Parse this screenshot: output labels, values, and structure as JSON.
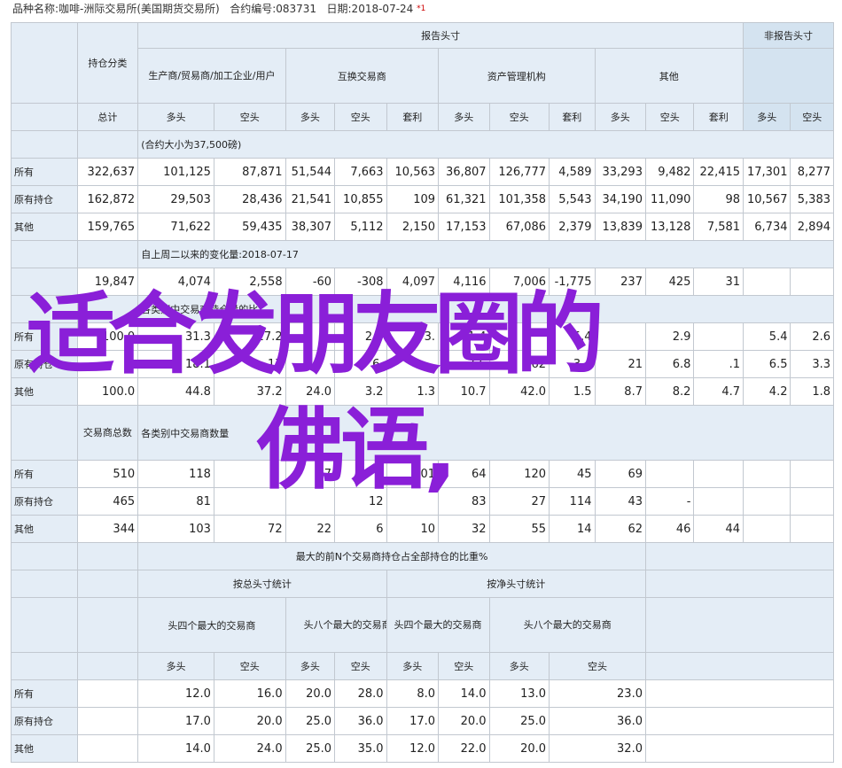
{
  "meta": {
    "variety": "品种名称:咖啡-洲际交易所(美国期货交易所)",
    "code": "合约编号:083731",
    "date": "日期:2018-07-24",
    "note": "*1"
  },
  "headers": {
    "reportable": "报告头寸",
    "nonreportable": "非报告头寸",
    "holding_class": "持仓分类",
    "producer": "生产商/贸易商/加工企业/用户",
    "swap": "互换交易商",
    "managed": "资产管理机构",
    "other": "其他",
    "total": "总计",
    "long": "多头",
    "short": "空头",
    "spread": "套利"
  },
  "sections": {
    "positions": "(合约大小为37,500磅)",
    "change": "自上周二以来的变化量:2018-07-17",
    "percent": "各类别中交易商持仓量的比",
    "traders_label": "交易商总数",
    "traders": "各类别中交易商数量"
  },
  "row_labels": {
    "all": "所有",
    "old": "原有持仓",
    "other": "其他"
  },
  "positions_rows": [
    {
      "label": "所有",
      "values": [
        "322,637",
        "101,125",
        "87,871",
        "51,544",
        "7,663",
        "10,563",
        "36,807",
        "126,777",
        "4,589",
        "33,293",
        "9,482",
        "22,415",
        "17,301",
        "8,277"
      ]
    },
    {
      "label": "原有持仓",
      "values": [
        "162,872",
        "29,503",
        "28,436",
        "21,541",
        "10,855",
        "109",
        "61,321",
        "101,358",
        "5,543",
        "34,190",
        "11,090",
        "98",
        "10,567",
        "5,383"
      ]
    },
    {
      "label": "其他",
      "values": [
        "159,765",
        "71,622",
        "59,435",
        "38,307",
        "5,112",
        "2,150",
        "17,153",
        "67,086",
        "2,379",
        "13,839",
        "13,128",
        "7,581",
        "6,734",
        "2,894"
      ]
    }
  ],
  "change_row": {
    "values": [
      "19,847",
      "4,074",
      "2,558",
      "-60",
      "-308",
      "4,097",
      "4,116",
      "7,006",
      "-1,775",
      "237",
      "425",
      "31"
    ]
  },
  "percent_rows": [
    {
      "label": "所有",
      "values": [
        "100.0",
        "31.3",
        "27.2",
        "",
        "2.4",
        "3.",
        "1.4",
        "",
        "5.4",
        "",
        "2.9",
        "",
        "5.4",
        "2.6"
      ]
    },
    {
      "label": "原有持仓",
      "values": [
        "",
        "18.1",
        "17",
        "",
        "6.",
        "",
        "7.6",
        "62",
        "3.4",
        "21",
        "6.8",
        ".1",
        "6.5",
        "3.3"
      ]
    },
    {
      "label": "其他",
      "values": [
        "100.0",
        "44.8",
        "37.2",
        "24.0",
        "3.2",
        "1.3",
        "10.7",
        "42.0",
        "1.5",
        "8.7",
        "8.2",
        "4.7",
        "4.2",
        "1.8"
      ]
    }
  ],
  "trader_rows": [
    {
      "label": "所有",
      "values": [
        "510",
        "118",
        "",
        "7",
        "",
        "101",
        "64",
        "120",
        "45",
        "69"
      ]
    },
    {
      "label": "原有持仓",
      "values": [
        "465",
        "81",
        "",
        "",
        "12",
        "",
        "83",
        "27",
        "114",
        "43",
        "-"
      ]
    },
    {
      "label": "其他",
      "values": [
        "344",
        "103",
        "72",
        "22",
        "6",
        "10",
        "32",
        "55",
        "14",
        "62",
        "46",
        "44"
      ]
    }
  ],
  "concentration": {
    "title": "最大的前N个交易商持仓占全部持仓的比重%",
    "gross": "按总头寸统计",
    "net": "按净头寸统计",
    "top4": "头四个最大的交易商",
    "top8": "头八个最大的交易商",
    "rows": [
      {
        "label": "所有",
        "values": [
          "12.0",
          "16.0",
          "20.0",
          "28.0",
          "8.0",
          "14.0",
          "13.0",
          "23.0"
        ]
      },
      {
        "label": "原有持仓",
        "values": [
          "17.0",
          "20.0",
          "25.0",
          "36.0",
          "17.0",
          "20.0",
          "25.0",
          "36.0"
        ]
      },
      {
        "label": "其他",
        "values": [
          "14.0",
          "24.0",
          "25.0",
          "35.0",
          "12.0",
          "22.0",
          "20.0",
          "32.0"
        ]
      }
    ]
  },
  "overlay": {
    "line1": "适合发朋友圈的",
    "line2": "佛语,"
  }
}
